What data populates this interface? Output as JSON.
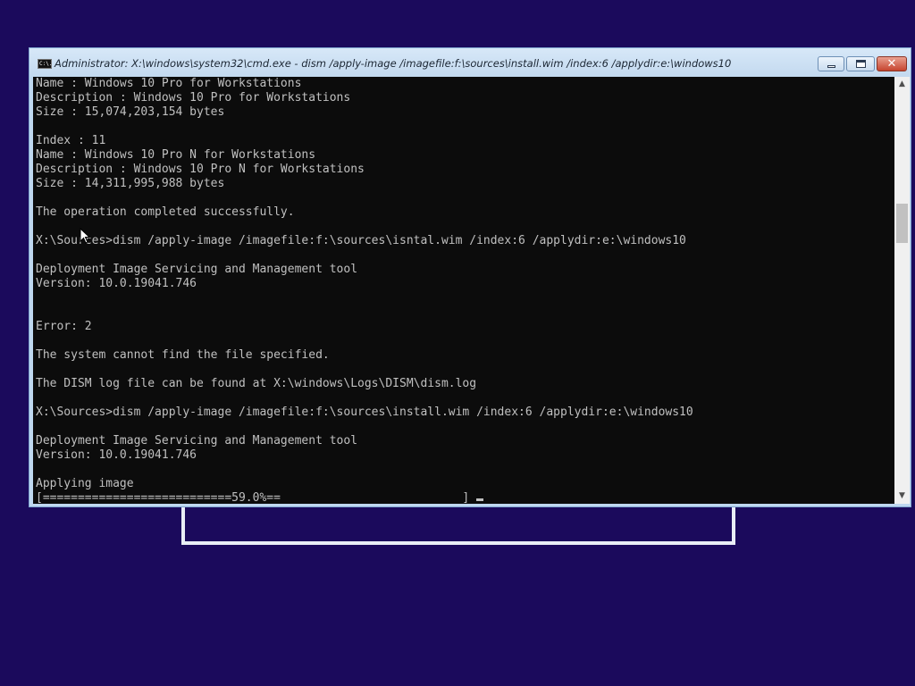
{
  "window": {
    "title": "Administrator: X:\\windows\\system32\\cmd.exe - dism  /apply-image /imagefile:f:\\sources\\install.wim /index:6 /applydir:e:\\windows10",
    "icon": "cmd-icon",
    "icon_text": "C:\\."
  },
  "buttons": {
    "minimize": "minimize-icon",
    "maximize": "maximize-icon",
    "close": "close-icon",
    "close_label": "✕"
  },
  "console": {
    "lines": [
      "Name : Windows 10 Pro for Workstations",
      "Description : Windows 10 Pro for Workstations",
      "Size : 15,074,203,154 bytes",
      "",
      "Index : 11",
      "Name : Windows 10 Pro N for Workstations",
      "Description : Windows 10 Pro N for Workstations",
      "Size : 14,311,995,988 bytes",
      "",
      "The operation completed successfully.",
      "",
      "X:\\Sources>dism /apply-image /imagefile:f:\\sources\\isntal.wim /index:6 /applydir:e:\\windows10",
      "",
      "Deployment Image Servicing and Management tool",
      "Version: 10.0.19041.746",
      "",
      "",
      "Error: 2",
      "",
      "The system cannot find the file specified.",
      "",
      "The DISM log file can be found at X:\\windows\\Logs\\DISM\\dism.log",
      "",
      "X:\\Sources>dism /apply-image /imagefile:f:\\sources\\install.wim /index:6 /applydir:e:\\windows10",
      "",
      "Deployment Image Servicing and Management tool",
      "Version: 10.0.19041.746",
      "",
      "Applying image"
    ],
    "progress_line": "[===========================59.0%==                          ]",
    "progress_percent": 59.0
  },
  "scrollbar": {
    "up_icon": "scroll-up-arrow-icon",
    "down_icon": "scroll-down-arrow-icon",
    "up_glyph": "▲",
    "down_glyph": "▼"
  },
  "colors": {
    "desktop_background": "#1b0a5c",
    "console_background": "#0c0c0c",
    "console_text": "#c0c0c0",
    "titlebar": "#c3d9ef",
    "close_button": "#c6452f"
  }
}
